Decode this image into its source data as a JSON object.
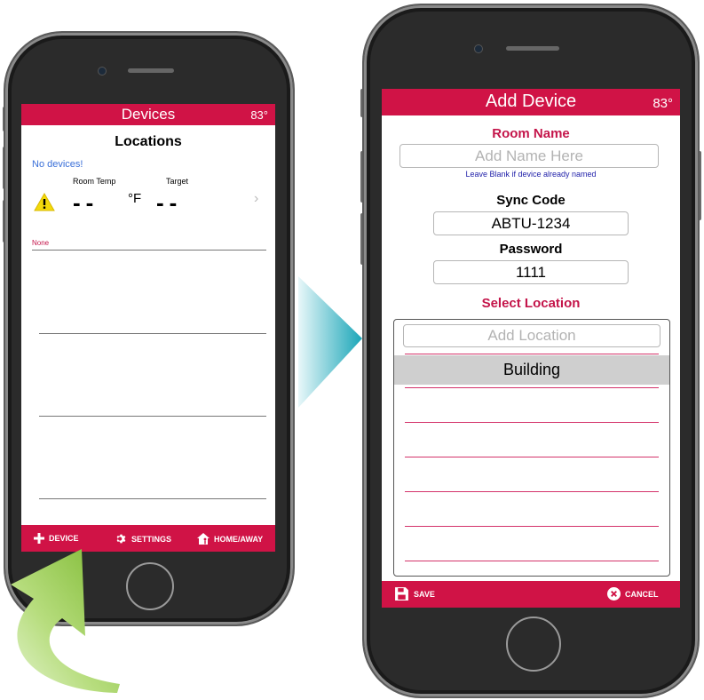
{
  "left_screen": {
    "header_title": "Devices",
    "header_temp": "83°",
    "section_title": "Locations",
    "no_devices": "No devices!",
    "room_temp_label": "Room Temp",
    "target_label": "Target",
    "room_temp_value": "--",
    "unit": "°F",
    "target_value": "--",
    "location_label": "None",
    "bottom": {
      "device": "DEVICE",
      "settings": "SETTINGS",
      "home_away": "HOME/AWAY"
    }
  },
  "right_screen": {
    "header_title": "Add Device",
    "header_temp": "83°",
    "room_name_label": "Room Name",
    "room_name_placeholder": "Add Name Here",
    "room_name_hint": "Leave Blank if device already named",
    "sync_code_label": "Sync Code",
    "sync_code_value": "ABTU-1234",
    "password_label": "Password",
    "password_value": "1111",
    "select_location_label": "Select Location",
    "add_location_placeholder": "Add Location",
    "locations": [
      "Building"
    ],
    "bottom": {
      "save": "SAVE",
      "cancel": "CANCEL"
    }
  },
  "colors": {
    "brand": "#d01346",
    "accent_text": "#c4154a",
    "link_blue": "#3a6fd8",
    "selected_row": "#cfcfcf",
    "arrow_teal": "#1aa6b8",
    "arrow_green": "#8cc63f"
  }
}
